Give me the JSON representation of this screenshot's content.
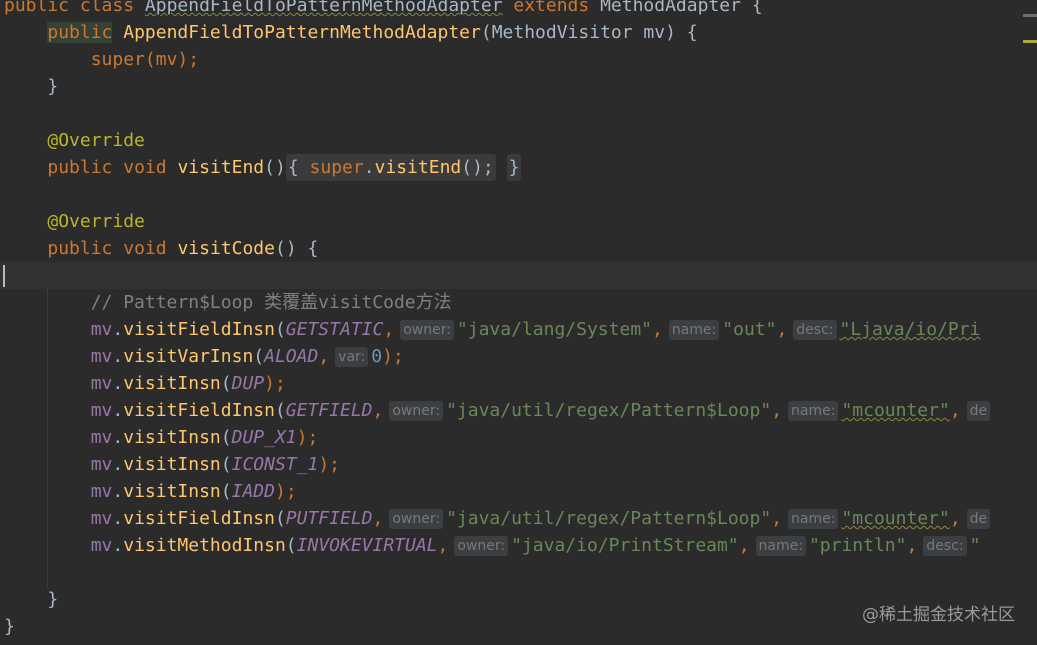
{
  "code": {
    "l1": {
      "kw1": "public",
      "kw2": "class",
      "name": "AppendFieldToPatternMethodAdapter",
      "kw3": "extends",
      "base": "MethodAdapter",
      "brace": "{"
    },
    "l2": {
      "kw": "public",
      "name": "AppendFieldToPatternMethodAdapter",
      "params": "(MethodVisitor mv) {"
    },
    "l3": {
      "kw": "super",
      "rest": "(mv);"
    },
    "l4": "}",
    "l6": "@Override",
    "l7": {
      "kw1": "public",
      "kw2": "void",
      "name": "visitEnd",
      "paren": "()",
      "fold_open": "{",
      "super": "super",
      "dot": ".",
      "call": "visitEnd",
      "tail": "();",
      "fold_close": "}"
    },
    "l9": "@Override",
    "l10": {
      "kw1": "public",
      "kw2": "void",
      "name": "visitCode",
      "rest": "() {"
    },
    "comment": "// Pattern$Loop 类覆盖visitCode方法",
    "calls": [
      {
        "obj": "mv",
        "method": "visitFieldInsn",
        "const": "GETSTATIC",
        "hints": [
          {
            "h": "owner:",
            "v": "\"java/lang/System\""
          },
          {
            "h": "name:",
            "v": "\"out\""
          },
          {
            "h": "desc:",
            "v": "\"Ljava/io/Pri"
          }
        ]
      },
      {
        "obj": "mv",
        "method": "visitVarInsn",
        "const": "ALOAD",
        "var_hint": "var:",
        "var_val": "0",
        "end": ");"
      },
      {
        "obj": "mv",
        "method": "visitInsn",
        "const": "DUP",
        "end": ");"
      },
      {
        "obj": "mv",
        "method": "visitFieldInsn",
        "const": "GETFIELD",
        "hints": [
          {
            "h": "owner:",
            "v": "\"java/util/regex/Pattern$Loop\""
          },
          {
            "h": "name:",
            "v": "\"mcounter\""
          },
          {
            "h": "de",
            "v": ""
          }
        ]
      },
      {
        "obj": "mv",
        "method": "visitInsn",
        "const": "DUP_X1",
        "end": ");"
      },
      {
        "obj": "mv",
        "method": "visitInsn",
        "const": "ICONST_1",
        "end": ");"
      },
      {
        "obj": "mv",
        "method": "visitInsn",
        "const": "IADD",
        "end": ");"
      },
      {
        "obj": "mv",
        "method": "visitFieldInsn",
        "const": "PUTFIELD",
        "hints": [
          {
            "h": "owner:",
            "v": "\"java/util/regex/Pattern$Loop\""
          },
          {
            "h": "name:",
            "v": "\"mcounter\""
          },
          {
            "h": "de",
            "v": ""
          }
        ]
      },
      {
        "obj": "mv",
        "method": "visitMethodInsn",
        "const": "INVOKEVIRTUAL",
        "hints": [
          {
            "h": "owner:",
            "v": "\"java/io/PrintStream\""
          },
          {
            "h": "name:",
            "v": "\"println\""
          },
          {
            "h": "desc:",
            "v": "\""
          }
        ]
      }
    ],
    "close_method": "}",
    "close_class": "}"
  },
  "watermark": "@稀土掘金技术社区",
  "colors": {
    "background": "#2b2b2b",
    "keyword": "#cc7832",
    "function": "#ffc66d",
    "string": "#6a8759",
    "constant": "#9876aa",
    "annotation": "#bbb529",
    "number": "#6897bb"
  }
}
